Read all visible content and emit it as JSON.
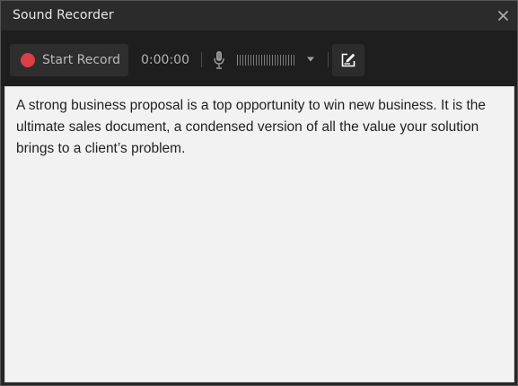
{
  "window": {
    "title": "Sound Recorder",
    "close_icon": "close-icon"
  },
  "toolbar": {
    "record_label": "Start Record",
    "record_icon": "record-dot-icon",
    "record_color": "#d93f45",
    "timer": "0:00:00",
    "mic_icon": "microphone-icon",
    "level_meter": {
      "total_bars": 22,
      "active_bars": 1,
      "active_color": "#3dbb3d"
    },
    "dropdown_icon": "caret-down-icon",
    "edit_icon": "edit-note-icon"
  },
  "transcript": {
    "text": "A strong business proposal is a top opportunity to win new business. It is the ultimate sales document, a condensed version of all the value your solution brings to a client’s problem."
  }
}
